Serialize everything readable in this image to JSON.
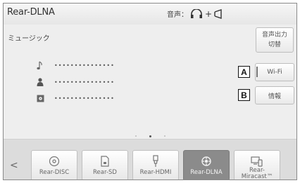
{
  "header": {
    "title": "Rear-DLNA",
    "audio_output_label": "音声："
  },
  "section_label": "ミュージック",
  "buttons": {
    "audio_switch": [
      "音声出力",
      "切替"
    ],
    "wifi": "Wi-Fi",
    "info": "情報"
  },
  "callouts": {
    "a": "A",
    "b": "B"
  },
  "track_info": {
    "song": "•••••••••••••••",
    "artist": "•••••••••••••••",
    "album": "•••••••••••••••"
  },
  "sources": [
    {
      "label": "Rear-DISC",
      "icon": "disc-icon"
    },
    {
      "label": "Rear-SD",
      "icon": "sd-card-icon"
    },
    {
      "label": "Rear-HDMI",
      "icon": "hdmi-plug-icon"
    },
    {
      "label": "Rear-DLNA",
      "icon": "dlna-icon",
      "selected": true
    },
    {
      "label_lines": [
        "Rear-",
        "Miracast™"
      ],
      "icon": "miracast-icon"
    }
  ],
  "colors": {
    "selected_source_bg": "#8b8b8b",
    "screen_bg": "#eeeeee"
  }
}
